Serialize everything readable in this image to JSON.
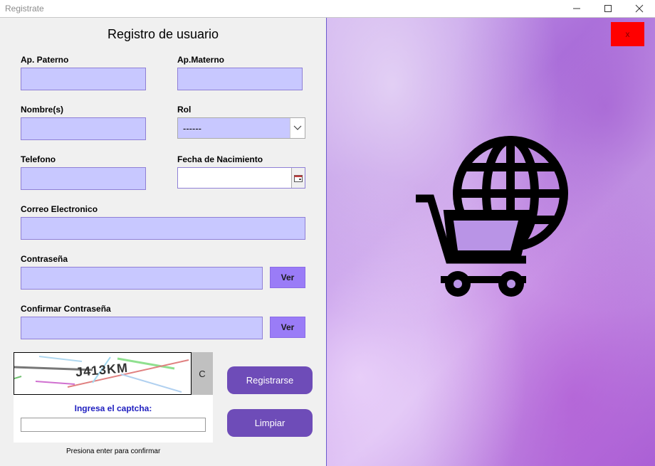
{
  "window": {
    "title": "Registrate",
    "minimize_glyph": "—",
    "maximize_glyph": "☐",
    "close_glyph": "✕"
  },
  "form": {
    "heading": "Registro de usuario",
    "ap_paterno_label": "Ap. Paterno",
    "ap_materno_label": "Ap.Materno",
    "nombre_label": "Nombre(s)",
    "rol_label": "Rol",
    "rol_selected": "------",
    "telefono_label": "Telefono",
    "fecha_label": "Fecha de Nacimiento",
    "correo_label": "Correo Electronico",
    "contrasena_label": "Contraseña",
    "confirmar_label": "Confirmar Contraseña",
    "ver_label": "Ver",
    "ver_confirm_label": "Ver"
  },
  "captcha": {
    "code": "J413KM",
    "refresh_label": "C",
    "prompt": "Ingresa el captcha:",
    "hint": "Presiona enter para confirmar"
  },
  "actions": {
    "register_label": "Registrarse",
    "clear_label": "Limpiar",
    "close_label": "x"
  },
  "colors": {
    "input_bg": "#c8c8ff",
    "ver_button": "#9a7cf7",
    "primary_button": "#6e4cb8",
    "close_button": "#ff0000",
    "captcha_prompt": "#2020c0"
  },
  "icons": {
    "illustration": "shopping-cart-globe-icon",
    "dropdown": "chevron-down-icon",
    "calendar": "calendar-icon"
  }
}
